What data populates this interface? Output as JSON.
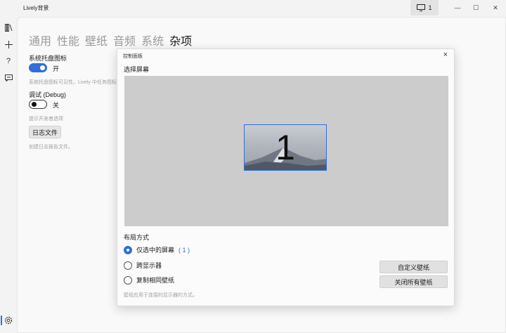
{
  "app": {
    "title": "Lively背景",
    "monitor_button_label": "1",
    "minimize": "—",
    "maximize": "☐",
    "close": "✕"
  },
  "rail": {
    "icons": [
      "library-icon",
      "add-icon",
      "help-icon",
      "feedback-icon",
      "settings-icon"
    ]
  },
  "tabs": [
    "通用",
    "性能",
    "壁纸",
    "音频",
    "系统",
    "杂项"
  ],
  "active_tab": "杂项",
  "settings": {
    "tray_label": "系统托盘图标",
    "tray_state": "开",
    "tray_desc": "系统托盘图标可见性。Lively 中任务图标",
    "debug_label": "调试 (Debug)",
    "debug_state": "关",
    "debug_desc": "提示开发者选项",
    "log_button": "日志文件",
    "log_desc": "创建日志报告文件。"
  },
  "dialog": {
    "title": "控制面板",
    "close": "×",
    "heading": "选择屏幕",
    "monitor_number": "1",
    "layout_heading": "布局方式",
    "options": [
      {
        "label": "仅选中的屏幕",
        "count": "( 1 )",
        "checked": true
      },
      {
        "label": "跨显示器",
        "count": "",
        "checked": false
      },
      {
        "label": "复制相同壁纸",
        "count": "",
        "checked": false
      }
    ],
    "note": "壁纸应用于连接的显示器的方式。",
    "customize_button": "自定义壁纸",
    "close_all_button": "关闭所有壁纸"
  },
  "colors": {
    "accent": "#2f6fd6",
    "screen_area": "#cccccc"
  }
}
